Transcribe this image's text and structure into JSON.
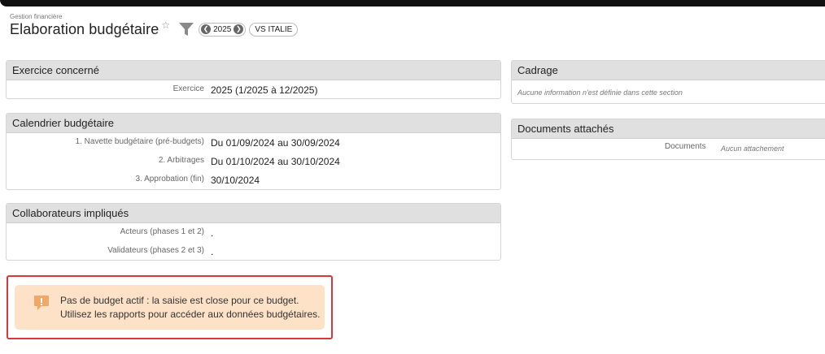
{
  "header": {
    "breadcrumb": "Gestion financière",
    "title": "Elaboration budgétaire",
    "year": "2025",
    "tag": "VS ITALIE"
  },
  "exercice": {
    "title": "Exercice concerné",
    "rows": [
      {
        "label": "Exercice",
        "value": "2025 (1/2025 à 12/2025)"
      }
    ]
  },
  "calendrier": {
    "title": "Calendrier budgétaire",
    "rows": [
      {
        "label": "1. Navette budgétaire (pré-budgets)",
        "value": "Du 01/09/2024 au 30/09/2024"
      },
      {
        "label": "2. Arbitrages",
        "value": "Du 01/10/2024 au 30/10/2024"
      },
      {
        "label": "3. Approbation (fin)",
        "value": "30/10/2024"
      }
    ]
  },
  "collaborateurs": {
    "title": "Collaborateurs impliqués",
    "rows": [
      {
        "label": "Acteurs (phases 1 et 2)",
        "value": "."
      },
      {
        "label": "Validateurs (phases 2 et 3)",
        "value": "."
      }
    ]
  },
  "cadrage": {
    "title": "Cadrage",
    "empty_text": "Aucune information n'est définie dans cette section"
  },
  "documents": {
    "title": "Documents attachés",
    "label": "Documents",
    "value": "Aucun attachement"
  },
  "alert": {
    "line1": "Pas de budget actif : la saisie est close pour ce budget.",
    "line2": "Utilisez les rapports pour accéder aux données budgétaires."
  },
  "colors": {
    "alert_border": "#d9363e",
    "alert_background": "#fde2c7",
    "alert_icon": "#f0a868",
    "panel_header": "#e0e0e0"
  }
}
